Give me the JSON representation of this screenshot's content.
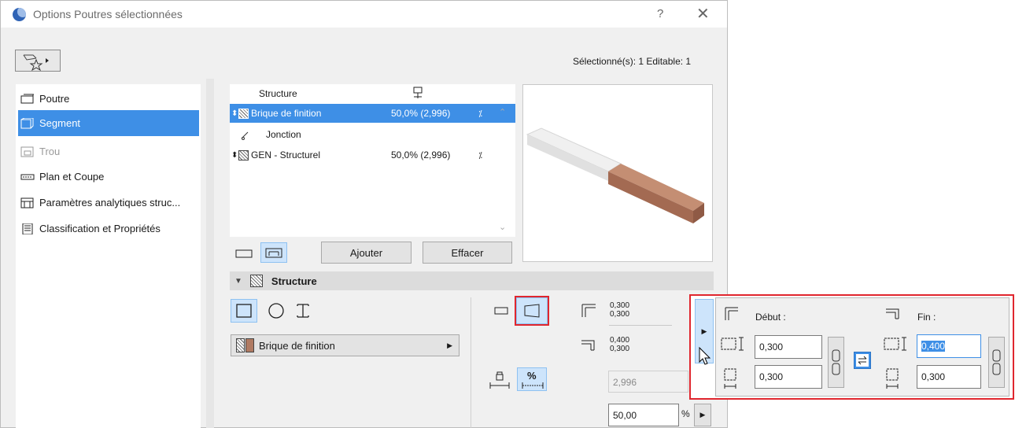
{
  "window": {
    "title": "Options Poutres sélectionnées",
    "help": "?",
    "close": "✕",
    "selection_info": "Sélectionné(s): 1 Editable: 1"
  },
  "nav": {
    "items": [
      {
        "label": "Poutre",
        "icon": "beam-icon"
      },
      {
        "label": "Segment",
        "icon": "segment-icon",
        "selected": true
      },
      {
        "label": "Trou",
        "icon": "hole-icon",
        "disabled": true
      },
      {
        "label": "Plan et Coupe",
        "icon": "plan-section-icon"
      },
      {
        "label": "Paramètres analytiques struc...",
        "icon": "analytic-icon"
      },
      {
        "label": "Classification et Propriétés",
        "icon": "classification-icon"
      }
    ]
  },
  "skin_list": {
    "header_label": "Structure",
    "rows": [
      {
        "name": "Brique de finition",
        "value": "50,0% (2,996)",
        "selected": true
      },
      {
        "name": "Jonction",
        "value": ""
      },
      {
        "name": "GEN - Structurel",
        "value": "50,0% (2,996)"
      }
    ]
  },
  "buttons": {
    "add": "Ajouter",
    "delete": "Effacer"
  },
  "section": {
    "title": "Structure"
  },
  "material": {
    "label": "Brique de finition",
    "colors": {
      "brick": "#b07a62"
    }
  },
  "dims": {
    "start_w": "0,300",
    "start_h": "0,300",
    "end_w": "0,400",
    "end_h": "0,300",
    "length": "2,996",
    "percent": "50,00",
    "percent_sign": "%",
    "pct_label": "%"
  },
  "popout": {
    "start_label": "Début :",
    "end_label": "Fin :",
    "start_height": "0,300",
    "start_width": "0,300",
    "end_height": "0,400",
    "end_width": "0,300"
  },
  "colors": {
    "accent": "#3e8fe6",
    "highlight": "#e0262e"
  }
}
